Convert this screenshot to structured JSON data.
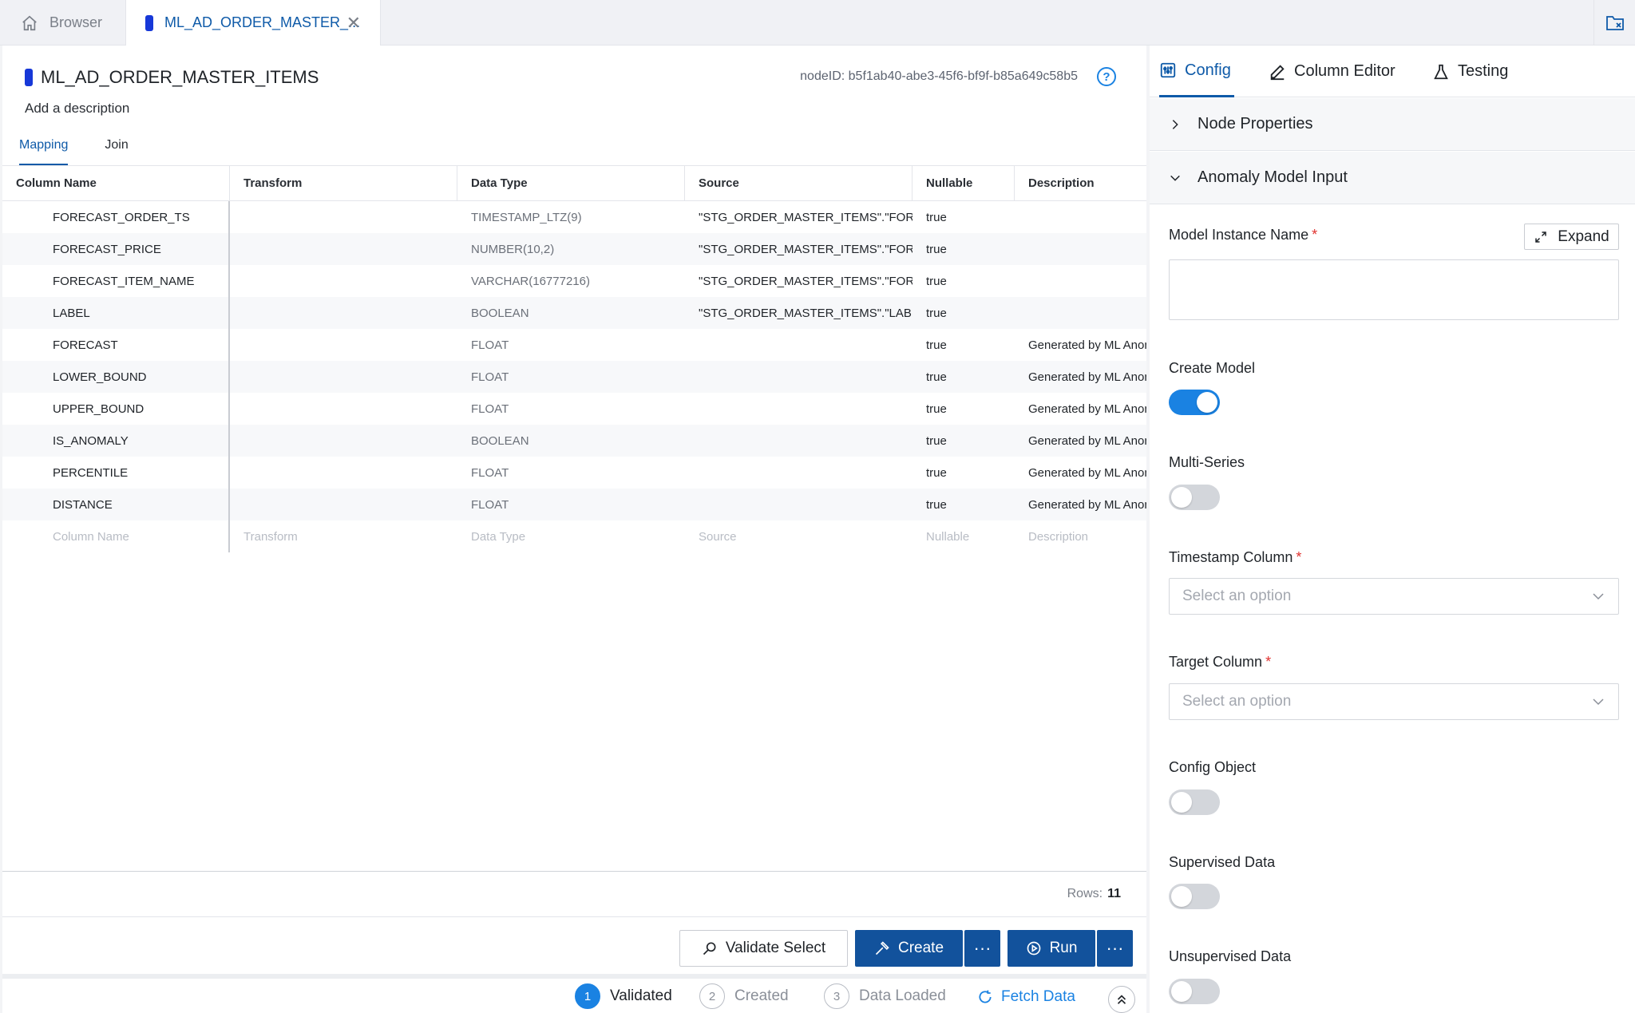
{
  "tabs": {
    "browser": "Browser",
    "node": "ML_AD_ORDER_MASTER_..."
  },
  "node": {
    "title": "ML_AD_ORDER_MASTER_ITEMS",
    "description_placeholder": "Add a description",
    "node_id": "nodeID: b5f1ab40-abe3-45f6-bf9f-b85a649c58b5"
  },
  "subtabs": [
    "Mapping",
    "Join"
  ],
  "grid": {
    "headers": [
      "Column Name",
      "Transform",
      "Data Type",
      "Source",
      "Nullable",
      "Description"
    ],
    "rows": [
      [
        "FORECAST_ORDER_TS",
        "",
        "TIMESTAMP_LTZ(9)",
        "\"STG_ORDER_MASTER_ITEMS\".\"FORECAST_ORDER_TS\"",
        "true",
        ""
      ],
      [
        "FORECAST_PRICE",
        "",
        "NUMBER(10,2)",
        "\"STG_ORDER_MASTER_ITEMS\".\"FORECAST_PRICE\"",
        "true",
        ""
      ],
      [
        "FORECAST_ITEM_NAME",
        "",
        "VARCHAR(16777216)",
        "\"STG_ORDER_MASTER_ITEMS\".\"FORECAST_ITEM_NAME\"",
        "true",
        ""
      ],
      [
        "LABEL",
        "",
        "BOOLEAN",
        "\"STG_ORDER_MASTER_ITEMS\".\"LABEL\"",
        "true",
        ""
      ],
      [
        "FORECAST",
        "",
        "FLOAT",
        "",
        "true",
        "Generated by ML Anomaly"
      ],
      [
        "LOWER_BOUND",
        "",
        "FLOAT",
        "",
        "true",
        "Generated by ML Anomaly"
      ],
      [
        "UPPER_BOUND",
        "",
        "FLOAT",
        "",
        "true",
        "Generated by ML Anomaly"
      ],
      [
        "IS_ANOMALY",
        "",
        "BOOLEAN",
        "",
        "true",
        "Generated by ML Anomaly"
      ],
      [
        "PERCENTILE",
        "",
        "FLOAT",
        "",
        "true",
        "Generated by ML Anomaly"
      ],
      [
        "DISTANCE",
        "",
        "FLOAT",
        "",
        "true",
        "Generated by ML Anomaly"
      ]
    ],
    "placeholder_row": [
      "Column Name",
      "Transform",
      "Data Type",
      "Source",
      "Nullable",
      "Description"
    ]
  },
  "rows_label": "Rows:",
  "rows_count": "11",
  "actions": {
    "validate": "Validate Select",
    "create": "Create",
    "run": "Run",
    "more": "···"
  },
  "status": {
    "steps": [
      {
        "num": "1",
        "label": "Validated"
      },
      {
        "num": "2",
        "label": "Created"
      },
      {
        "num": "3",
        "label": "Data Loaded"
      }
    ],
    "fetch": "Fetch Data"
  },
  "right_tabs": [
    "Config",
    "Column Editor",
    "Testing"
  ],
  "sections": {
    "node_properties": "Node Properties",
    "anomaly_input": "Anomaly Model Input"
  },
  "fields": {
    "model_instance_name": "Model Instance Name",
    "expand": "Expand",
    "create_model": "Create Model",
    "multi_series": "Multi-Series",
    "timestamp_column": "Timestamp Column",
    "target_column": "Target Column",
    "select_placeholder": "Select an option",
    "config_object": "Config Object",
    "supervised_data": "Supervised Data",
    "unsupervised_data": "Unsupervised Data",
    "required_mark": "*"
  },
  "toggles": {
    "create_model": true,
    "multi_series": false,
    "config_object": false,
    "supervised_data": false,
    "unsupervised_data": false
  },
  "colors": {
    "accent": "#1a82e2",
    "primary_button": "#12529c",
    "active_tab": "#0e5aa8",
    "node_pill": "#1738d8"
  },
  "icons": [
    "home-icon",
    "node-type-icon",
    "close-icon",
    "help-icon",
    "config-icon",
    "pencil-icon",
    "flask-icon",
    "chevron-right-icon",
    "chevron-down-icon",
    "expand-icon",
    "search-validate-icon",
    "hammer-icon",
    "play-circle-icon",
    "refresh-icon",
    "double-chevron-up-icon",
    "folder-close-icon"
  ]
}
